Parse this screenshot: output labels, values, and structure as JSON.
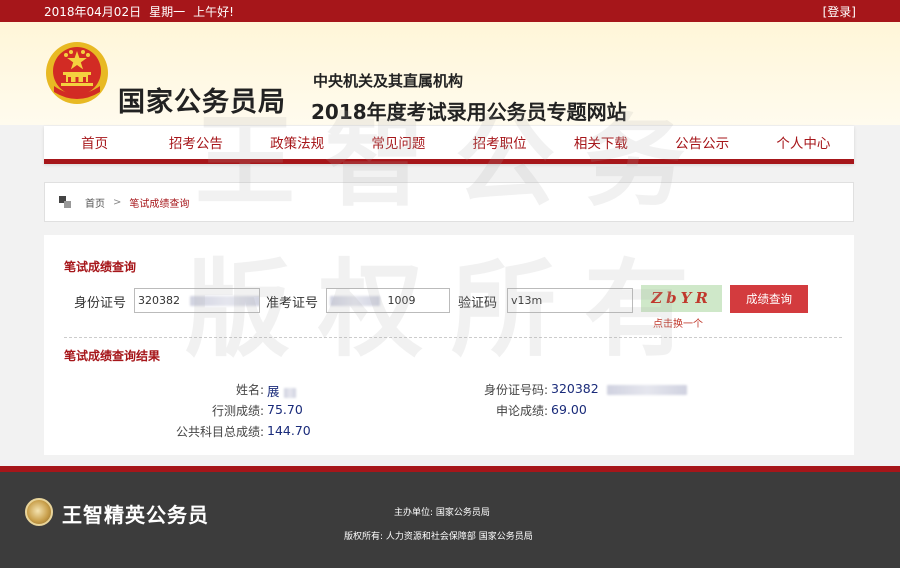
{
  "topbar": {
    "date": "2018年04月02日",
    "weekday": "星期一",
    "greeting": "上午好!",
    "login": "[登录]"
  },
  "header": {
    "site_name": "国家公务员局",
    "subtitle_1": "中央机关及其直属机构",
    "subtitle_2": "2018年度考试录用公务员专题网站"
  },
  "nav": {
    "items": [
      "首页",
      "招考公告",
      "政策法规",
      "常见问题",
      "招考职位",
      "相关下载",
      "公告公示",
      "个人中心"
    ]
  },
  "breadcrumb": {
    "home": "首页",
    "separator": ">",
    "current": "笔试成绩查询"
  },
  "query": {
    "title": "笔试成绩查询",
    "id_label": "身份证号",
    "id_value": "320382",
    "admission_label": "准考证号",
    "admission_value": "1009",
    "captcha_label": "验证码",
    "captcha_value": "v13m",
    "captcha_text": "ZbYR",
    "refresh_label": "点击换一个",
    "submit_label": "成绩查询"
  },
  "result": {
    "title": "笔试成绩查询结果",
    "name_label": "姓名:",
    "name_value": "展",
    "xingce_label": "行测成绩:",
    "xingce_value": "75.70",
    "total_label": "公共科目总成绩:",
    "total_value": "144.70",
    "id_label": "身份证号码:",
    "id_value": "320382",
    "shenlun_label": "申论成绩:",
    "shenlun_value": "69.00"
  },
  "footer": {
    "brand": "王智精英公务员",
    "host_label": "主办单位:",
    "host_value": "国家公务员局",
    "copyright_label": "版权所有:",
    "copyright_value": "人力资源和社会保障部  国家公务员局"
  },
  "watermark": {
    "line1": "王智公务",
    "line2": "版权所有"
  },
  "colors": {
    "brand_red": "#a6161a",
    "button_red": "#d33b3e",
    "value_blue": "#1a2b7a",
    "footer_bg": "#3c3c3c",
    "header_bg": "#fff6d8"
  },
  "icons": {
    "emblem": "national-emblem-icon",
    "breadcrumb": "breadcrumb-icon",
    "footer_logo": "wangzhi-logo-icon"
  }
}
